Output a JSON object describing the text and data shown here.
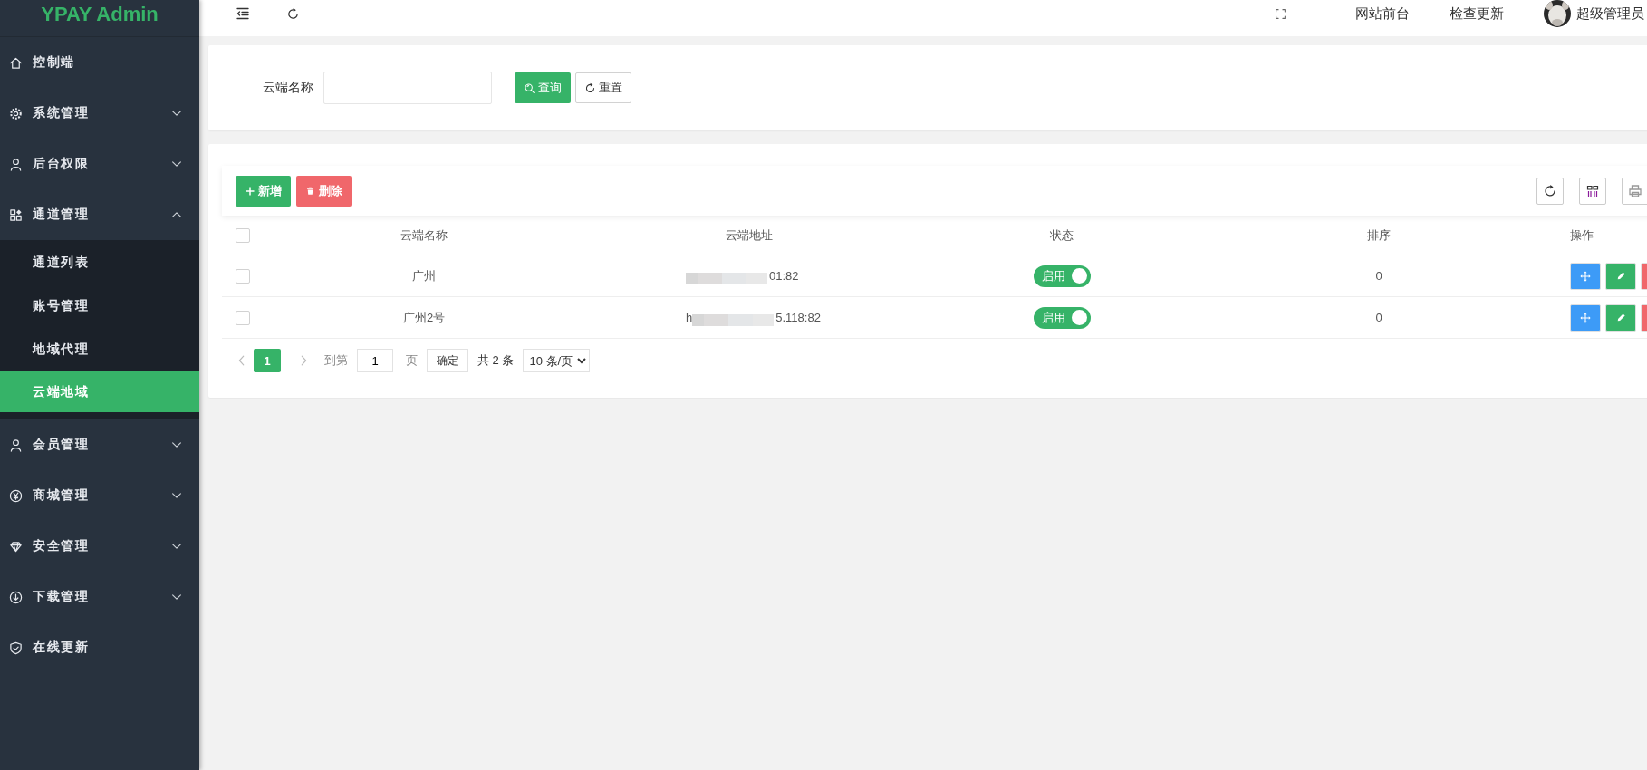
{
  "sidebar": {
    "logo": "YPAY Admin",
    "items": [
      {
        "kind": "link",
        "label": "控制端"
      },
      {
        "kind": "group",
        "label": "系统管理",
        "expanded": false
      },
      {
        "kind": "group",
        "label": "后台权限",
        "expanded": false
      },
      {
        "kind": "group",
        "label": "通道管理",
        "expanded": true,
        "children": [
          {
            "label": "通道列表",
            "selected": false
          },
          {
            "label": "账号管理",
            "selected": false
          },
          {
            "label": "地域代理",
            "selected": false
          },
          {
            "label": "云端地域",
            "selected": true
          }
        ]
      },
      {
        "kind": "group",
        "label": "会员管理",
        "expanded": false
      },
      {
        "kind": "group",
        "label": "商城管理",
        "expanded": false
      },
      {
        "kind": "group",
        "label": "安全管理",
        "expanded": false
      },
      {
        "kind": "group",
        "label": "下载管理",
        "expanded": false
      },
      {
        "kind": "link",
        "label": "在线更新"
      }
    ]
  },
  "top_bar": {
    "links": [
      "网站前台",
      "检查更新"
    ],
    "user": "超级管理员"
  },
  "search": {
    "fields": [
      {
        "label": "云端名称"
      }
    ],
    "buttons": [
      {
        "label": "查询",
        "kind": "search"
      },
      {
        "label": "重置",
        "kind": "reset"
      }
    ]
  },
  "table": {
    "toolbar": [
      {
        "label": "新增",
        "kind": "add"
      },
      {
        "label": "删除",
        "kind": "delete"
      }
    ],
    "all_checked": false,
    "columns": [
      "云端名称",
      "云端地址",
      "状态",
      "排序",
      "操作"
    ],
    "rows": [
      {
        "checked": false,
        "name": "广州",
        "address": {
          "end": "01:82"
        },
        "status": {
          "label": "启用",
          "on": true
        },
        "sort": "0"
      },
      {
        "checked": false,
        "name": "广州2号",
        "address": {
          "start": "h",
          "end": "5.118:82"
        },
        "status": {
          "label": "启用",
          "on": true
        },
        "sort": "0"
      }
    ]
  },
  "pagination": {
    "pages": [
      {
        "label": "1",
        "selected": true
      }
    ],
    "goto_label": "到第",
    "goto_value": "1",
    "page_unit": "页",
    "confirm": "确定",
    "total": "共 2 条",
    "page_size": "10 条/页"
  }
}
